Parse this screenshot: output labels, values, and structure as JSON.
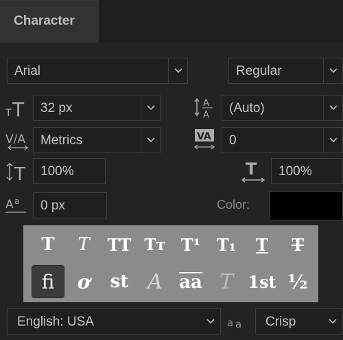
{
  "panel": {
    "tab_label": "Character"
  },
  "font": {
    "family": "Arial",
    "style": "Regular"
  },
  "size": {
    "font_size": "32 px",
    "leading": "(Auto)"
  },
  "spacing": {
    "kerning": "Metrics",
    "tracking": "0"
  },
  "scale": {
    "vertical": "100%",
    "horizontal": "100%"
  },
  "baseline": {
    "shift": "0 px"
  },
  "color": {
    "label": "Color:",
    "value": "#000000"
  },
  "styles": {
    "row1": [
      {
        "glyph": "T",
        "name": "faux-bold"
      },
      {
        "glyph": "T",
        "name": "faux-italic"
      },
      {
        "glyph": "TT",
        "name": "all-caps"
      },
      {
        "glyph": "Tт",
        "name": "small-caps"
      },
      {
        "glyph": "T¹",
        "name": "superscript"
      },
      {
        "glyph": "T₁",
        "name": "subscript"
      },
      {
        "glyph": "T",
        "name": "underline"
      },
      {
        "glyph": "T",
        "name": "strikethrough"
      }
    ],
    "row2": [
      {
        "glyph": "fi",
        "name": "standard-ligatures",
        "active": true
      },
      {
        "glyph": "ơ",
        "name": "contextual-alternates"
      },
      {
        "glyph": "st",
        "name": "discretionary-ligatures"
      },
      {
        "glyph": "A",
        "name": "swash"
      },
      {
        "glyph": "aa",
        "name": "stylistic-alternates"
      },
      {
        "glyph": "T",
        "name": "titling-alternates"
      },
      {
        "glyph": "1st",
        "name": "ordinals"
      },
      {
        "glyph": "½",
        "name": "fractions"
      }
    ]
  },
  "language": {
    "value": "English: USA"
  },
  "antialias": {
    "value": "Crisp"
  },
  "colors": {
    "bg": "#232323",
    "field": "#1f1f1f",
    "style_panel": "#8b8b8b"
  }
}
